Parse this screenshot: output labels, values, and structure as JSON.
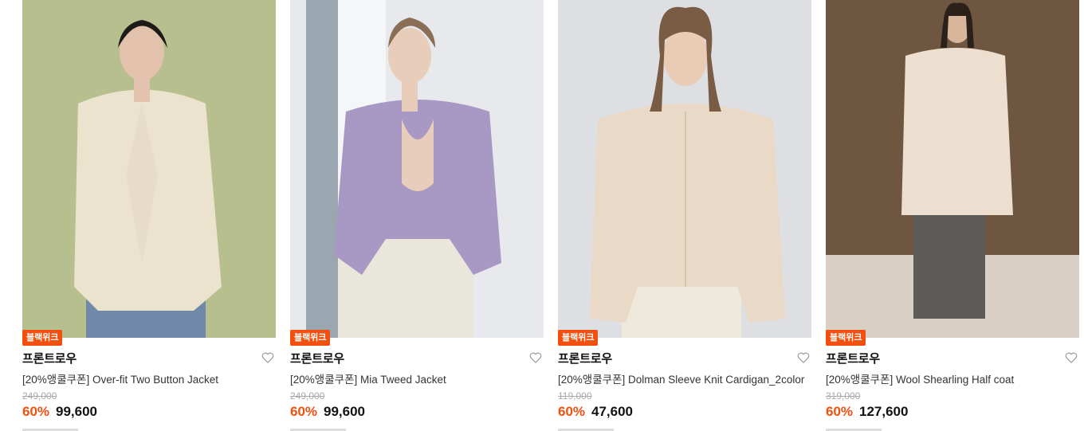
{
  "badge_label": "블랙위크",
  "products": [
    {
      "brand": "프론트로우",
      "name": "[20%앵쿨쿠폰] Over-fit Two Button Jacket",
      "original_price": "249,000",
      "discount": "60%",
      "price": "99,600",
      "colors": {
        "bg": "#b7bf8e",
        "garment": "#ece3cf",
        "skin": "#e3c2ad",
        "hair": "#1e1a18",
        "accent": "#7189a9"
      }
    },
    {
      "brand": "프론트로우",
      "name": "[20%앵쿨쿠폰] Mia Tweed Jacket",
      "original_price": "249,000",
      "discount": "60%",
      "price": "99,600",
      "colors": {
        "bg": "#e7e9ec",
        "garment": "#a898c4",
        "skin": "#e8cdbb",
        "hair": "#8a6e56",
        "accent": "#e9e6dc"
      }
    },
    {
      "brand": "프론트로우",
      "name": "[20%앵쿨쿠폰] Dolman Sleeve Knit Cardigan_2color",
      "original_price": "119,000",
      "discount": "60%",
      "price": "47,600",
      "colors": {
        "bg": "#dedfe2",
        "garment": "#ead9c7",
        "skin": "#e9cbb6",
        "hair": "#7a5b44",
        "accent": "#efe9dc"
      }
    },
    {
      "brand": "프론트로우",
      "name": "[20%앵쿨쿠폰] Wool Shearling Half coat",
      "original_price": "319,000",
      "discount": "60%",
      "price": "127,600",
      "colors": {
        "bg": "#6e5641",
        "garment": "#ecdfd0",
        "skin": "#d9b59c",
        "hair": "#2b201a",
        "accent": "#5e5a58"
      }
    }
  ]
}
